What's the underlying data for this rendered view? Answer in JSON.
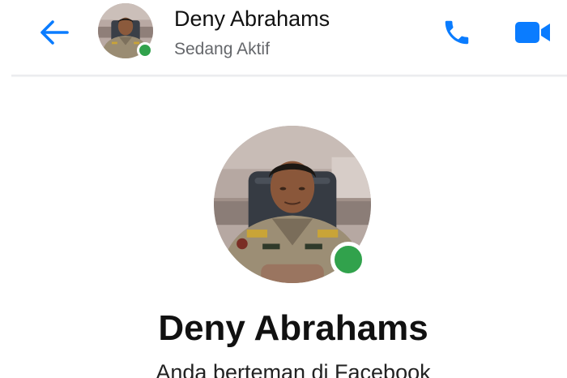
{
  "header": {
    "back_icon": "arrow-left-icon",
    "contact_name": "Deny Abrahams",
    "status": "Sedang Aktif",
    "call_icon": "phone-icon",
    "video_icon": "video-camera-icon"
  },
  "profile": {
    "name": "Deny Abrahams",
    "subtitle": "Anda berteman di Facebook",
    "online": true
  },
  "colors": {
    "accent": "#0a7cff",
    "online": "#31a24c",
    "secondary_text": "#65676b"
  }
}
